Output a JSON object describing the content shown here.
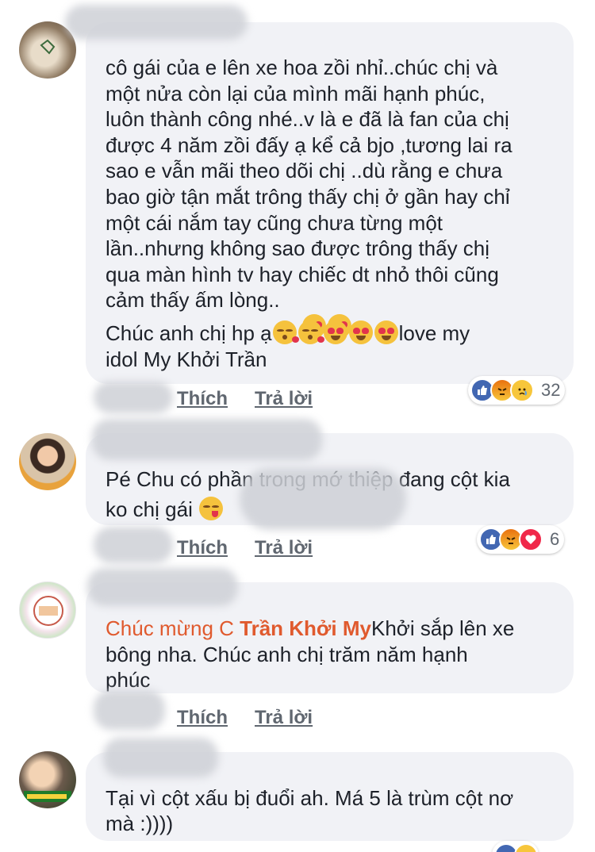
{
  "comments": [
    {
      "text": "cô gái của e lên xe hoa  zồi nhỉ..chúc chị và\nmột nửa còn lại của mình mãi hạnh phúc,\nluôn thành công nhé..v là e đã là fan của chị\nđược 4 năm zồi đấy ạ kể cả bjo ,tương lai ra\nsao e vẫn mãi theo dõi chị ..dù rằng e chưa\nbao giờ tận mắt trông thấy chị ở gần hay chỉ\nmột cái nắm tay cũng chưa từng một\nlần..nhưng không sao được trông thấy chị\nqua màn hình tv hay chiếc dt nhỏ thôi cũng\ncảm thấy ấm lòng..",
      "line2_pre": "Chúc anh chị hp ạ",
      "line2_post": "love my",
      "line3": "idol My Khởi Trần",
      "like": "Thích",
      "reply": "Trả lời",
      "reaction_count": "32"
    },
    {
      "line1": "Pé Chu có phần trong mớ thiệp đang cột kia",
      "line2": "ko chị gái",
      "like": "Thích",
      "reply": "Trả lời",
      "reaction_count": "6"
    },
    {
      "mention1": "Chúc mừng",
      "mention_c": " C ",
      "mention_name": "Trần Khởi My",
      "rest": "Khởi sắp lên xe",
      "line2": "bông nha. Chúc anh chị trăm năm hạnh",
      "line3": "phúc",
      "like": "Thích",
      "reply": "Trả lời"
    },
    {
      "line1": "Tại vì cột xấu bị đuổi ah. Má 5 là trùm cột nơ",
      "line2": "mà :))))"
    }
  ],
  "colors": {
    "bubble": "#f1f2f6",
    "mention": "#e05a2e",
    "like_blue": "#4267b2",
    "love_red": "#f0284a"
  },
  "icons": [
    "like-reaction-icon",
    "angry-reaction-icon",
    "sad-reaction-icon",
    "love-reaction-icon",
    "haha-reaction-icon",
    "heart-eyes-emoji",
    "kiss-emoji",
    "yum-emoji"
  ]
}
